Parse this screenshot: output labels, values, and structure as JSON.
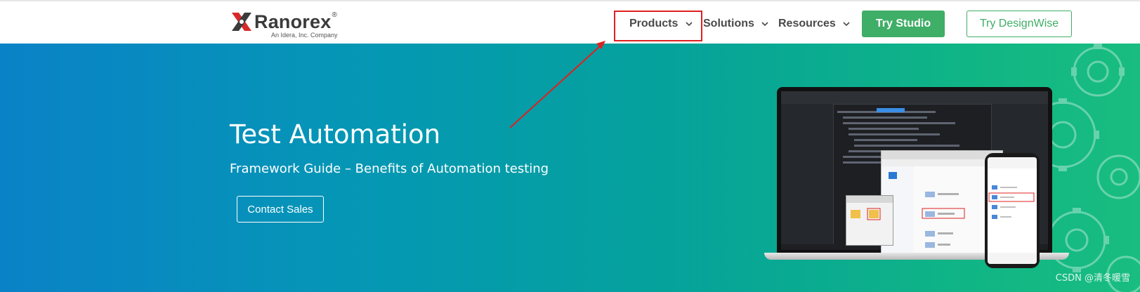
{
  "header": {
    "logo": {
      "wordmark": "Ranorex",
      "registered": "®",
      "tagline": "An Idera, Inc. Company"
    },
    "nav": [
      {
        "label": "Products",
        "icon": "chevron-down-icon"
      },
      {
        "label": "Solutions",
        "icon": "chevron-down-icon"
      },
      {
        "label": "Resources",
        "icon": "chevron-down-icon"
      }
    ],
    "cta_primary": "Try Studio",
    "cta_secondary": "Try DesignWise"
  },
  "hero": {
    "title": "Test Automation",
    "subtitle": "Framework Guide – Benefits of Automation testing",
    "contact_button": "Contact Sales"
  },
  "annotation": {
    "highlight_color": "#e02020",
    "target": "Products"
  },
  "watermark": "CSDN @清冬暖雪",
  "colors": {
    "accent_green": "#3fae66",
    "hero_start": "#0a82c7",
    "hero_end": "#19bd80"
  }
}
